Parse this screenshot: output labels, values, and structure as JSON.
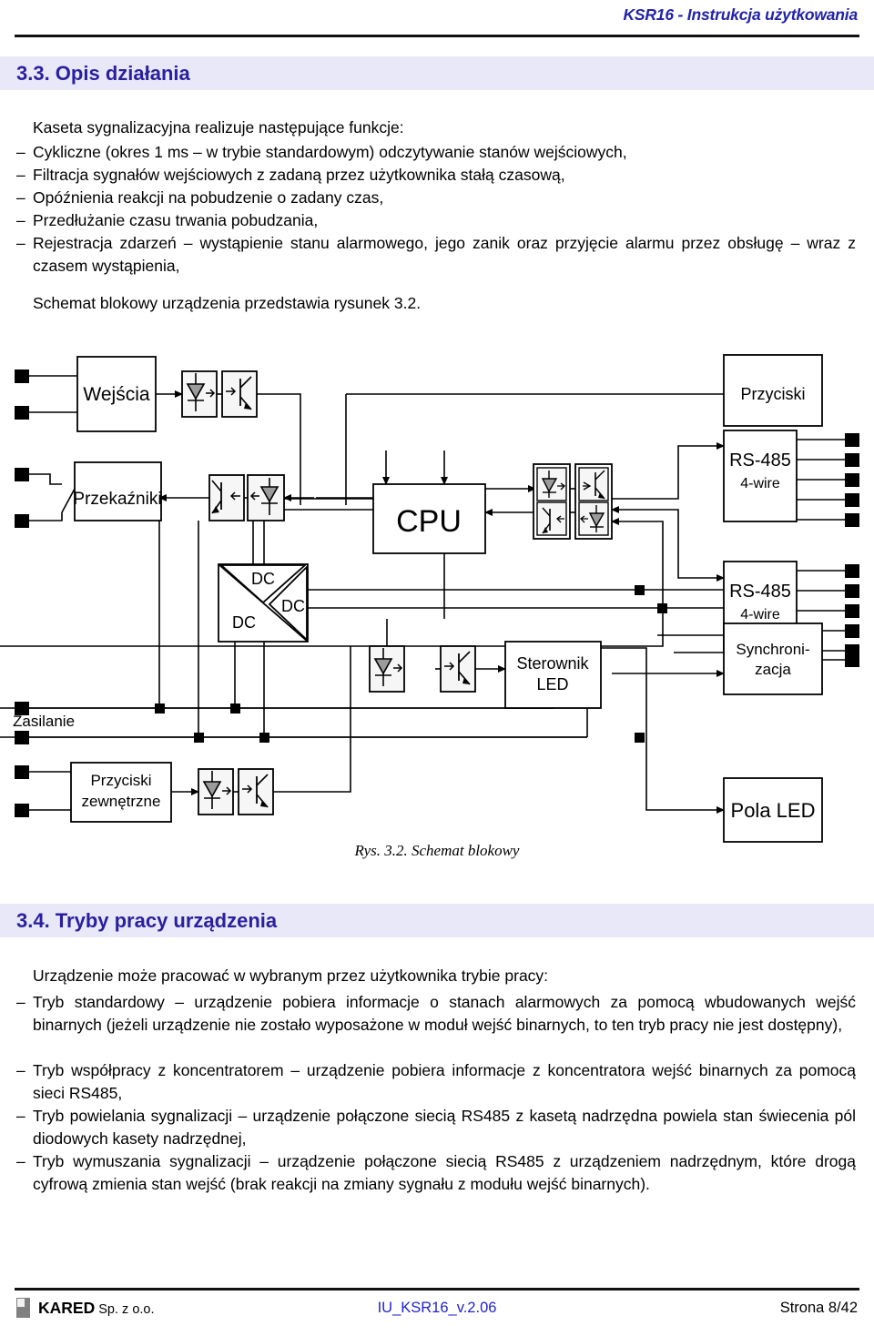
{
  "header": {
    "title": "KSR16 - Instrukcja użytkowania"
  },
  "section_33": {
    "heading": "3.3. Opis działania",
    "intro": "Kaseta sygnalizacyjna realizuje następujące funkcje:",
    "dash": "–",
    "bullets": [
      "Cykliczne (okres 1 ms – w trybie standardowym) odczytywanie stanów wejściowych,",
      "Filtracja sygnałów wejściowych z zadaną przez użytkownika stałą czasową,",
      "Opóźnienia reakcji na pobudzenie o zadany czas,",
      "Przedłużanie czasu trwania pobudzania,",
      "Rejestracja zdarzeń – wystąpienie stanu alarmowego, jego zanik oraz przyjęcie alarmu przez obsługę – wraz z czasem wystąpienia,"
    ],
    "figure_ref": "Schemat blokowy urządzenia przedstawia rysunek 3.2."
  },
  "figure": {
    "caption": "Rys. 3.2. Schemat blokowy",
    "blocks": {
      "wejscia": "Wejścia",
      "przyciski": "Przyciski",
      "przekazniki": "Przekaźniki",
      "cpu": "CPU",
      "rs485_1_line1": "RS-485",
      "rs485_1_line2": "4-wire",
      "rs485_2_line1": "RS-485",
      "rs485_2_line2": "4-wire",
      "synchro_line1": "Synchroni-",
      "synchro_line2": "zacja",
      "dcdc_a": "DC",
      "dcdc_b": "DC",
      "dcdc_c": "DC",
      "sterownik_line1": "Sterownik",
      "sterownik_line2": "LED",
      "zasilanie": "Zasilanie",
      "przyciski_zew_line1": "Przyciski",
      "przyciski_zew_line2": "zewnętrzne",
      "pola_led": "Pola LED"
    }
  },
  "section_34": {
    "heading": "3.4. Tryby pracy urządzenia",
    "intro": "Urządzenie może pracować w wybranym przez użytkownika trybie pracy:",
    "dash": "–",
    "bullets": [
      "Tryb standardowy – urządzenie pobiera informacje o stanach alarmowych za pomocą wbudowanych wejść binarnych (jeżeli urządzenie nie zostało wyposażone w moduł wejść binarnych, to ten tryb pracy nie jest dostępny),",
      "Tryb współpracy  z koncentratorem – urządzenie pobiera informacje z koncentratora wejść binarnych za pomocą sieci RS485,",
      "Tryb powielania sygnalizacji – urządzenie połączone siecią RS485 z kasetą nadrzędna powiela stan świecenia pól diodowych kasety nadrzędnej,",
      "Tryb wymuszania sygnalizacji – urządzenie połączone siecią RS485 z urządzeniem nadrzędnym, które drogą cyfrową zmienia stan wejść (brak reakcji na zmiany sygnału z modułu wejść binarnych)."
    ]
  },
  "footer": {
    "company_bold": "KARED",
    "company_rest": " Sp. z o.o.",
    "document_id": "IU_KSR16_v.2.06",
    "page_label": "Strona 8/42"
  },
  "colors": {
    "heading_text": "#2b1f9e",
    "heading_band": "#e8e8f8",
    "header_title": "#2222aa",
    "footer_link": "#2222cc",
    "rule": "#101010",
    "diagram_line": "#000000",
    "opto_fill": "#a0a0a0"
  }
}
